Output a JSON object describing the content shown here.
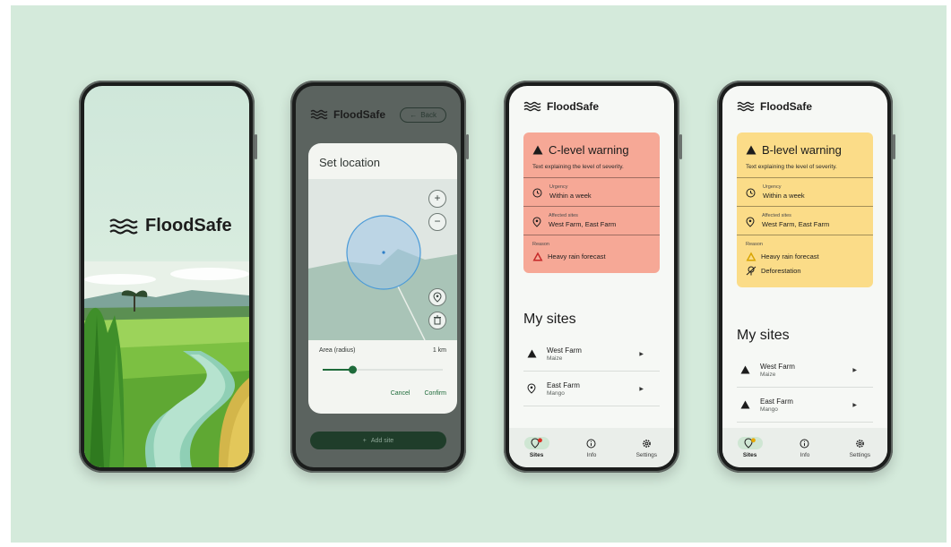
{
  "brand": {
    "name": "FloodSafe"
  },
  "location_dialog": {
    "back_label": "Back",
    "title": "Set location",
    "zoom_in": "+",
    "zoom_out": "−",
    "area_label": "Area (radius)",
    "area_value": "1 km",
    "radius_fraction": 0.25,
    "cancel_label": "Cancel",
    "confirm_label": "Confirm",
    "add_site_label": "Add site"
  },
  "warnings": [
    {
      "title": "C-level warning",
      "color": "#f6a896",
      "description": "Text explaining the level of severity.",
      "urgency_label": "Urgency",
      "urgency_value": "Within a week",
      "affected_label": "Affected sites",
      "affected_value": "West Farm, East Farm",
      "reason_label": "Reason",
      "reasons": [
        "Heavy rain forecast"
      ]
    },
    {
      "title": "B-level warning",
      "color": "#fbdc88",
      "description": "Text explaining the level of severity.",
      "urgency_label": "Urgency",
      "urgency_value": "Within a week",
      "affected_label": "Affected sites",
      "affected_value": "West Farm, East Farm",
      "reason_label": "Reason",
      "reasons": [
        "Heavy rain forecast",
        "Deforestation"
      ]
    }
  ],
  "my_sites": {
    "heading": "My sites",
    "sites": [
      {
        "name": "West Farm",
        "crop": "Maize"
      },
      {
        "name": "East Farm",
        "crop": "Mango"
      }
    ]
  },
  "nav": {
    "sites_label": "Sites",
    "info_label": "Info",
    "settings_label": "Settings"
  },
  "colors": {
    "background": "#d4eadb",
    "accent_green": "#1e6b3a",
    "c_warning": "#f6a896",
    "b_warning": "#fbdc88"
  }
}
